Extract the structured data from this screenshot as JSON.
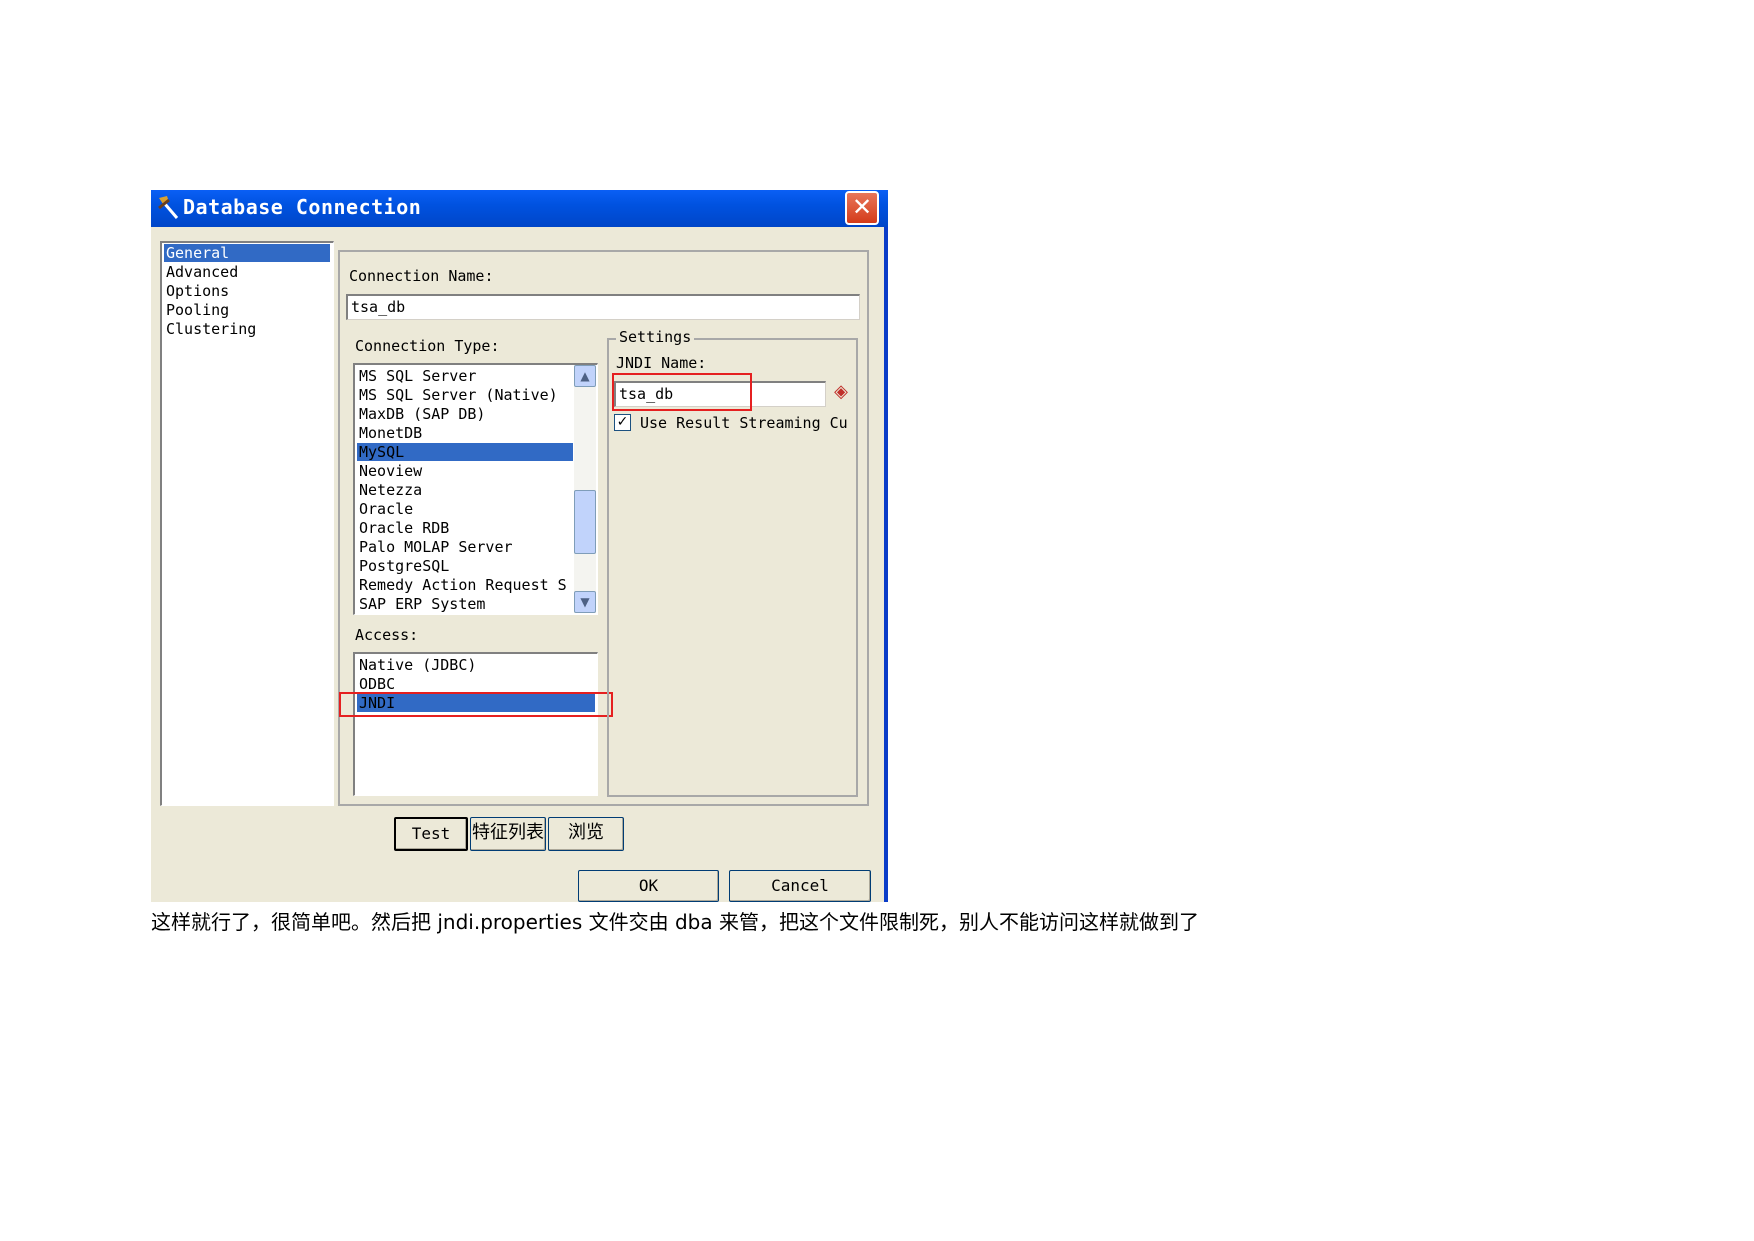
{
  "window": {
    "title": "Database Connection",
    "close_glyph": "✕",
    "title_bar_color": "#0052e0",
    "selection_color": "#316ac5",
    "highlight_color": "#e52020"
  },
  "nav": {
    "items": [
      "General",
      "Advanced",
      "Options",
      "Pooling",
      "Clustering"
    ],
    "selected": "General"
  },
  "general": {
    "connection_name_label": "Connection Name:",
    "connection_name_value": "tsa_db",
    "connection_type_label": "Connection Type:",
    "connection_types": [
      "MS SQL Server",
      "MS SQL Server (Native)",
      "MaxDB (SAP DB)",
      "MonetDB",
      "MySQL",
      "Neoview",
      "Netezza",
      "Oracle",
      "Oracle RDB",
      "Palo MOLAP Server",
      "PostgreSQL",
      "Remedy Action Request S",
      "SAP ERP System"
    ],
    "connection_type_selected": "MySQL",
    "access_label": "Access:",
    "access_types": [
      "Native (JDBC)",
      "ODBC",
      "JNDI"
    ],
    "access_selected": "JNDI",
    "settings": {
      "group_label": "Settings",
      "jndi_name_label": "JNDI Name:",
      "jndi_name_value": "tsa_db",
      "use_result_streaming_label": "Use Result Streaming Cu",
      "use_result_streaming_checked": true
    }
  },
  "buttons": {
    "test": "Test",
    "feature_list": "特征列表",
    "browse": "浏览",
    "ok": "OK",
    "cancel": "Cancel"
  },
  "icons": {
    "app": "spoon-icon",
    "variable": "diamond-variable-icon",
    "scroll_up": "chevron-up-icon",
    "scroll_down": "chevron-down-icon"
  },
  "caption": "这样就行了，很简单吧。然后把 jndi.properties  文件交由 dba 来管，把这个文件限制死，别人不能访问这样就做到了"
}
